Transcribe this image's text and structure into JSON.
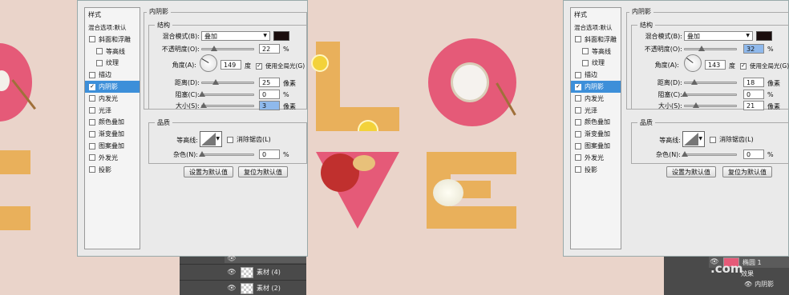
{
  "colors": {
    "background": "#ead4ca",
    "accent": "#3d8fd9",
    "letters": "#e9b05b",
    "plate": "#e55a78",
    "shadow_color": "#1a0d0d"
  },
  "left_dialog": {
    "styles_header": "样式",
    "blending_options": "混合选项:默认",
    "items": [
      {
        "label": "斜面和浮雕",
        "checked": false,
        "indent": false
      },
      {
        "label": "等高线",
        "checked": false,
        "indent": true
      },
      {
        "label": "纹理",
        "checked": false,
        "indent": true
      },
      {
        "label": "描边",
        "checked": false,
        "indent": false
      },
      {
        "label": "内阴影",
        "checked": true,
        "indent": false,
        "selected": true
      },
      {
        "label": "内发光",
        "checked": false,
        "indent": false
      },
      {
        "label": "光泽",
        "checked": false,
        "indent": false
      },
      {
        "label": "颜色叠加",
        "checked": false,
        "indent": false
      },
      {
        "label": "渐变叠加",
        "checked": false,
        "indent": false
      },
      {
        "label": "图案叠加",
        "checked": false,
        "indent": false
      },
      {
        "label": "外发光",
        "checked": false,
        "indent": false
      },
      {
        "label": "投影",
        "checked": false,
        "indent": false
      }
    ],
    "check_mark": "✓",
    "inner_shadow_title": "内阴影",
    "structure_title": "结构",
    "blend_mode_label": "混合模式(B):",
    "blend_mode_value": "叠加",
    "opacity_label": "不透明度(O):",
    "opacity_value": "22",
    "angle_label": "角度(A):",
    "angle_value": "149",
    "degree_unit": "度",
    "global_light_label": "使用全局光(G)",
    "distance_label": "距离(D):",
    "distance_value": "25",
    "choke_label": "阻塞(C):",
    "choke_value": "0",
    "size_label": "大小(S):",
    "size_value": "3",
    "pixel_unit": "像素",
    "percent_unit": "%",
    "quality_title": "品质",
    "contour_label": "等高线:",
    "antialias_label": "消除锯齿(L)",
    "noise_label": "杂色(N):",
    "noise_value": "0",
    "make_default": "设置为默认值",
    "reset_default": "复位为默认值",
    "slider_levels": {
      "opacity": 22,
      "distance": 25,
      "choke": 0,
      "size": 3,
      "noise": 0
    }
  },
  "right_dialog": {
    "styles_header": "样式",
    "blending_options": "混合选项:默认",
    "inner_shadow_title": "内阴影",
    "structure_title": "结构",
    "blend_mode_label": "混合模式(B):",
    "blend_mode_value": "叠加",
    "opacity_label": "不透明度(O):",
    "opacity_value": "32",
    "angle_label": "角度(A):",
    "angle_value": "143",
    "degree_unit": "度",
    "global_light_label": "使用全局光(G)",
    "distance_label": "距离(D):",
    "distance_value": "18",
    "choke_label": "阻塞(C):",
    "choke_value": "0",
    "size_label": "大小(S):",
    "size_value": "21",
    "pixel_unit": "像素",
    "percent_unit": "%",
    "quality_title": "品质",
    "contour_label": "等高线:",
    "antialias_label": "消除锯齿(L)",
    "noise_label": "杂色(N):",
    "noise_value": "0",
    "make_default": "设置为默认值",
    "reset_default": "复位为默认值",
    "slider_levels": {
      "opacity": 32,
      "distance": 18,
      "choke": 0,
      "size": 21,
      "noise": 0
    }
  },
  "layers_left": [
    {
      "name": "素材 (4)"
    },
    {
      "name": "素材 (2)"
    }
  ],
  "layers_right": {
    "layer_name": "椭圆 1",
    "effects": "效果",
    "effect_item": "内阴影",
    "eye": "👁"
  },
  "watermark": ".com"
}
